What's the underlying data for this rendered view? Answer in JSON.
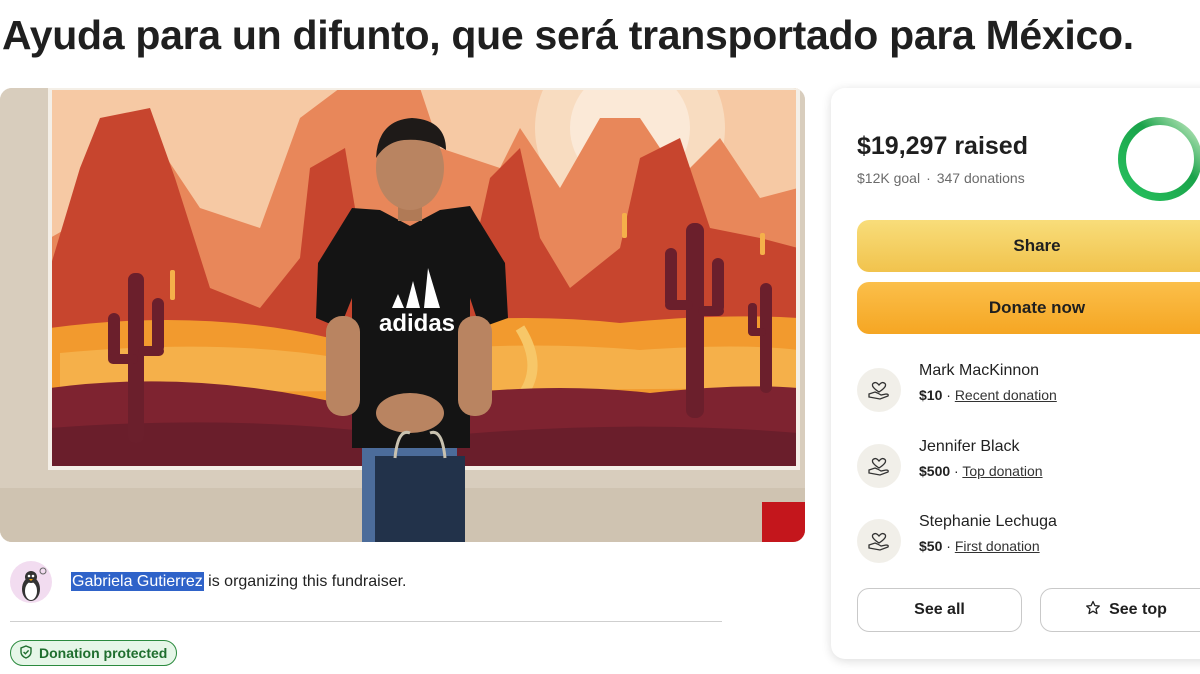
{
  "campaign": {
    "title": "Ayuda para un difunto, que será transportado para México."
  },
  "hero": {
    "shirt_text": "adidas"
  },
  "organizer": {
    "name": "Gabriela Gutierrez",
    "suffix": " is organizing this fundraiser."
  },
  "badge": {
    "label": "Donation protected"
  },
  "progress": {
    "raised": "$19,297 raised",
    "goal": "$12K goal",
    "separator": "·",
    "donations": "347 donations",
    "fraction_filled": 1.0,
    "ring_color": "#1aa34a"
  },
  "actions": {
    "share": "Share",
    "donate": "Donate now",
    "see_all": "See all",
    "see_top": "See top"
  },
  "donations": [
    {
      "name": "Mark MacKinnon",
      "amount": "$10",
      "sep": " · ",
      "tag": "Recent donation"
    },
    {
      "name": "Jennifer Black",
      "amount": "$500",
      "sep": " · ",
      "tag": "Top donation"
    },
    {
      "name": "Stephanie Lechuga",
      "amount": "$50",
      "sep": " · ",
      "tag": "First donation"
    }
  ]
}
